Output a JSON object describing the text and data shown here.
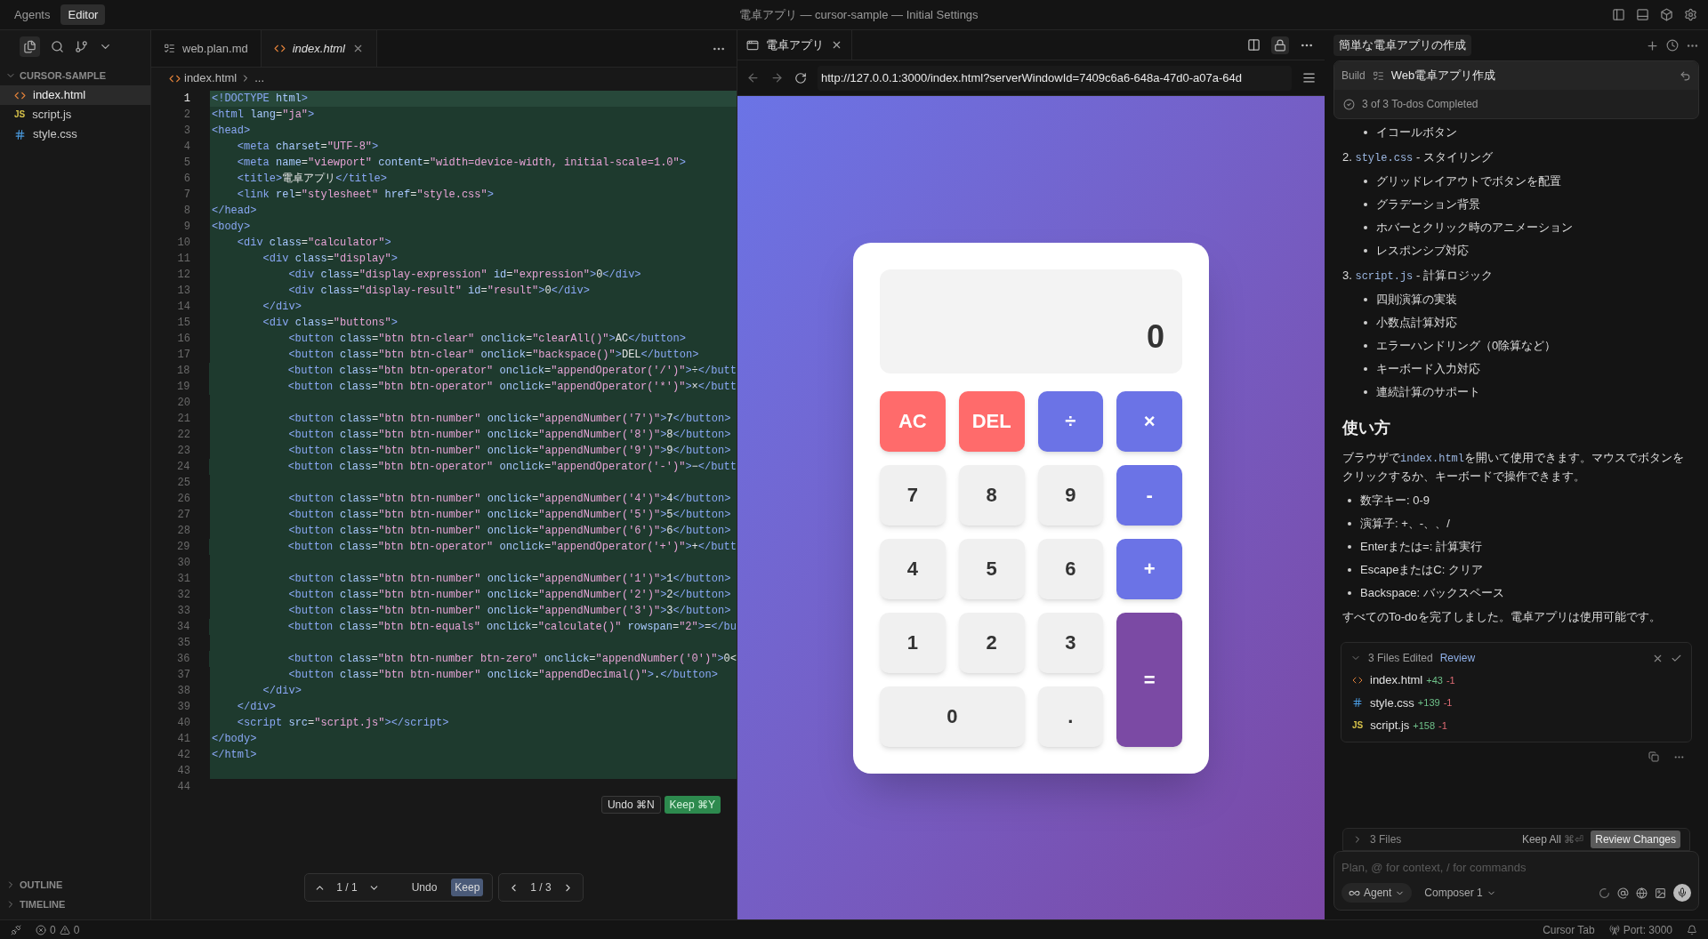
{
  "title_bar": {
    "modes": [
      {
        "label": "Agents",
        "selected": false
      },
      {
        "label": "Editor",
        "selected": true
      }
    ],
    "title": "電卓アプリ — cursor-sample — Initial Settings"
  },
  "sidebar": {
    "folder": {
      "name": "CURSOR-SAMPLE",
      "expanded": true,
      "files": [
        {
          "name": "index.html",
          "kind": "html",
          "selected": true
        },
        {
          "name": "script.js",
          "kind": "js",
          "icon_label": "JS",
          "selected": false
        },
        {
          "name": "style.css",
          "kind": "css",
          "selected": false
        }
      ]
    },
    "sections": [
      {
        "name": "OUTLINE",
        "expanded": false
      },
      {
        "name": "TIMELINE",
        "expanded": false
      }
    ]
  },
  "editor": {
    "tabs": [
      {
        "label": "web.plan.md",
        "kind": "plan",
        "selected": false
      },
      {
        "label": "index.html",
        "kind": "html",
        "selected": true
      }
    ],
    "breadcrumb": [
      "index.html",
      "..."
    ],
    "lines": [
      {
        "n": "1",
        "code": "<!DOCTYPE html>",
        "current": true,
        "added": true
      },
      {
        "n": "2",
        "code": "<html lang=\"ja\">",
        "current": false,
        "added": true
      },
      {
        "n": "3",
        "code": "<head>",
        "current": false,
        "added": true
      },
      {
        "n": "4",
        "code": "    <meta charset=\"UTF-8\">",
        "current": false,
        "added": true
      },
      {
        "n": "5",
        "code": "    <meta name=\"viewport\" content=\"width=device-width, initial-scale=1.0\">",
        "current": false,
        "added": true
      },
      {
        "n": "6",
        "code": "    <title>電卓アプリ</title>",
        "current": false,
        "added": true
      },
      {
        "n": "7",
        "code": "    <link rel=\"stylesheet\" href=\"style.css\">",
        "current": false,
        "added": true
      },
      {
        "n": "8",
        "code": "</head>",
        "current": false,
        "added": true
      },
      {
        "n": "9",
        "code": "<body>",
        "current": false,
        "added": true
      },
      {
        "n": "10",
        "code": "    <div class=\"calculator\">",
        "current": false,
        "added": true
      },
      {
        "n": "11",
        "code": "        <div class=\"display\">",
        "current": false,
        "added": true
      },
      {
        "n": "12",
        "code": "            <div class=\"display-expression\" id=\"expression\">0</div>",
        "current": false,
        "added": true
      },
      {
        "n": "13",
        "code": "            <div class=\"display-result\" id=\"result\">0</div>",
        "current": false,
        "added": true
      },
      {
        "n": "14",
        "code": "        </div>",
        "current": false,
        "added": true
      },
      {
        "n": "15",
        "code": "        <div class=\"buttons\">",
        "current": false,
        "added": true
      },
      {
        "n": "16",
        "code": "            <button class=\"btn btn-clear\" onclick=\"clearAll()\">AC</button>",
        "current": false,
        "added": true
      },
      {
        "n": "17",
        "code": "            <button class=\"btn btn-clear\" onclick=\"backspace()\">DEL</button>",
        "current": false,
        "added": true
      },
      {
        "n": "18",
        "code": "            <button class=\"btn btn-operator\" onclick=\"appendOperator('/')\">÷</butt",
        "current": false,
        "added": true
      },
      {
        "n": "19",
        "code": "            <button class=\"btn btn-operator\" onclick=\"appendOperator('*')\">×</butt",
        "current": false,
        "added": true
      },
      {
        "n": "20",
        "current": false,
        "added": true
      },
      {
        "n": "21",
        "code": "            <button class=\"btn btn-number\" onclick=\"appendNumber('7')\">7</button>",
        "current": false,
        "added": true
      },
      {
        "n": "22",
        "code": "            <button class=\"btn btn-number\" onclick=\"appendNumber('8')\">8</button>",
        "current": false,
        "added": true
      },
      {
        "n": "23",
        "code": "            <button class=\"btn btn-number\" onclick=\"appendNumber('9')\">9</button>",
        "current": false,
        "added": true
      },
      {
        "n": "24",
        "code": "            <button class=\"btn btn-operator\" onclick=\"appendOperator('-')\">−</butt",
        "current": false,
        "added": true
      },
      {
        "n": "25",
        "current": false,
        "added": true
      },
      {
        "n": "26",
        "code": "            <button class=\"btn btn-number\" onclick=\"appendNumber('4')\">4</button>",
        "current": false,
        "added": true
      },
      {
        "n": "27",
        "code": "            <button class=\"btn btn-number\" onclick=\"appendNumber('5')\">5</button>",
        "current": false,
        "added": true
      },
      {
        "n": "28",
        "code": "            <button class=\"btn btn-number\" onclick=\"appendNumber('6')\">6</button>",
        "current": false,
        "added": true
      },
      {
        "n": "29",
        "code": "            <button class=\"btn btn-operator\" onclick=\"appendOperator('+')\">+</butt",
        "current": false,
        "added": true
      },
      {
        "n": "30",
        "current": false,
        "added": true
      },
      {
        "n": "31",
        "code": "            <button class=\"btn btn-number\" onclick=\"appendNumber('1')\">1</button>",
        "current": false,
        "added": true
      },
      {
        "n": "32",
        "code": "            <button class=\"btn btn-number\" onclick=\"appendNumber('2')\">2</button>",
        "current": false,
        "added": true
      },
      {
        "n": "33",
        "code": "            <button class=\"btn btn-number\" onclick=\"appendNumber('3')\">3</button>",
        "current": false,
        "added": true
      },
      {
        "n": "34",
        "code": "            <button class=\"btn btn-equals\" onclick=\"calculate()\" rowspan=\"2\">=</bu",
        "current": false,
        "added": true
      },
      {
        "n": "35",
        "current": false,
        "added": true
      },
      {
        "n": "36",
        "code": "            <button class=\"btn btn-number btn-zero\" onclick=\"appendNumber('0')\">0<",
        "current": false,
        "added": true
      },
      {
        "n": "37",
        "code": "            <button class=\"btn btn-number\" onclick=\"appendDecimal()\">.</button>",
        "current": false,
        "added": true
      },
      {
        "n": "38",
        "code": "        </div>",
        "current": false,
        "added": true
      },
      {
        "n": "39",
        "code": "    </div>",
        "current": false,
        "added": true
      },
      {
        "n": "40",
        "code": "    <script src=\"script.js\"></script>",
        "current": false,
        "added": true
      },
      {
        "n": "41",
        "code": "</body>",
        "current": false,
        "added": true
      },
      {
        "n": "42",
        "code": "</html>",
        "current": false,
        "added": true
      },
      {
        "n": "43",
        "current": false,
        "added": true
      },
      {
        "n": "44",
        "current": false
      }
    ],
    "inline_actions": [
      {
        "kind": "undo",
        "label": "Undo",
        "shortcut": "⌘N"
      },
      {
        "kind": "keep",
        "label": "Keep",
        "shortcut": "⌘Y"
      }
    ],
    "review_bar": {
      "hunk": "1 / 1",
      "undo": "Undo",
      "keep": "Keep",
      "file": "1 / 3"
    }
  },
  "browser": {
    "tab": "電卓アプリ",
    "url": "http://127.0.0.1:3000/index.html?serverWindowId=7409c6a6-648a-47d0-a07a-64d",
    "calculator": {
      "result": "0",
      "buttons": [
        {
          "label": "AC",
          "kind": "clear"
        },
        {
          "label": "DEL",
          "kind": "clear"
        },
        {
          "label": "÷",
          "kind": "operator"
        },
        {
          "label": "×",
          "kind": "operator"
        },
        {
          "label": "7",
          "kind": "number"
        },
        {
          "label": "8",
          "kind": "number"
        },
        {
          "label": "9",
          "kind": "number"
        },
        {
          "label": "-",
          "kind": "operator"
        },
        {
          "label": "4",
          "kind": "number"
        },
        {
          "label": "5",
          "kind": "number"
        },
        {
          "label": "6",
          "kind": "number"
        },
        {
          "label": "+",
          "kind": "operator"
        },
        {
          "label": "1",
          "kind": "number"
        },
        {
          "label": "2",
          "kind": "number"
        },
        {
          "label": "3",
          "kind": "number"
        },
        {
          "label": "=",
          "kind": "equals"
        },
        {
          "label": "0",
          "kind": "zero"
        },
        {
          "label": ".",
          "kind": "number"
        }
      ]
    }
  },
  "agent_panel": {
    "chat_title": "簡単な電卓アプリの作成",
    "plan": {
      "label": "Build",
      "name": "Web電卓アプリ作成",
      "status": "3 of 3 To-dos Completed"
    },
    "content": [
      {
        "kind": "sub_bullet",
        "text": "イコールボタン"
      },
      {
        "kind": "numbered",
        "number": "2.",
        "code": "style.css",
        "text": "- スタイリング",
        "bullets": [
          "グリッドレイアウトでボタンを配置",
          "グラデーション背景",
          "ホバーとクリック時のアニメーション",
          "レスポンシブ対応"
        ]
      },
      {
        "kind": "numbered",
        "number": "3.",
        "code": "script.js",
        "text": "- 計算ロジック",
        "bullets": [
          "四則演算の実装",
          "小数点計算対応",
          "エラーハンドリング（0除算など）",
          "キーボード入力対応",
          "連続計算のサポート"
        ]
      },
      {
        "kind": "heading",
        "text": "使い方"
      },
      {
        "kind": "paragraph",
        "parts": [
          {
            "text": "ブラウザで"
          },
          {
            "code": "index.html"
          },
          {
            "text": "を開いて使用できます。マウスでボタンをクリックするか、キーボードで操作できます。"
          }
        ]
      },
      {
        "kind": "bullet",
        "text": "数字キー: 0-9"
      },
      {
        "kind": "bullet",
        "text": "演算子: +、-、、/"
      },
      {
        "kind": "bullet",
        "text": "Enterまたは=: 計算実行"
      },
      {
        "kind": "bullet",
        "text": "EscapeまたはC: クリア"
      },
      {
        "kind": "bullet",
        "text": "Backspace: バックスペース"
      },
      {
        "kind": "paragraph",
        "parts": [
          {
            "text": "すべてのTo-doを完了しました。電卓アプリは使用可能です。"
          }
        ]
      }
    ],
    "files_edited": {
      "title": "3 Files Edited",
      "action": "Review",
      "expanded": true,
      "files": [
        {
          "name": "index.html",
          "kind": "html",
          "added": "+43",
          "removed": "-1"
        },
        {
          "name": "style.css",
          "kind": "css",
          "added": "+139",
          "removed": "-1"
        },
        {
          "name": "script.js",
          "kind": "js",
          "icon_label": "JS",
          "added": "+158",
          "removed": "-1"
        }
      ]
    },
    "changes_bar": {
      "summary": "3 Files",
      "expanded": false,
      "keep_all": "Keep All",
      "keep_all_shortcut": "⌘⏎",
      "review": "Review Changes"
    },
    "composer": {
      "placeholder": "Plan, @ for context, / for commands",
      "mode": "Agent",
      "model": "Composer 1"
    }
  },
  "status_bar": {
    "errors": "0",
    "warnings": "0",
    "items": [
      "Cursor Tab",
      "Port: 3000"
    ]
  }
}
